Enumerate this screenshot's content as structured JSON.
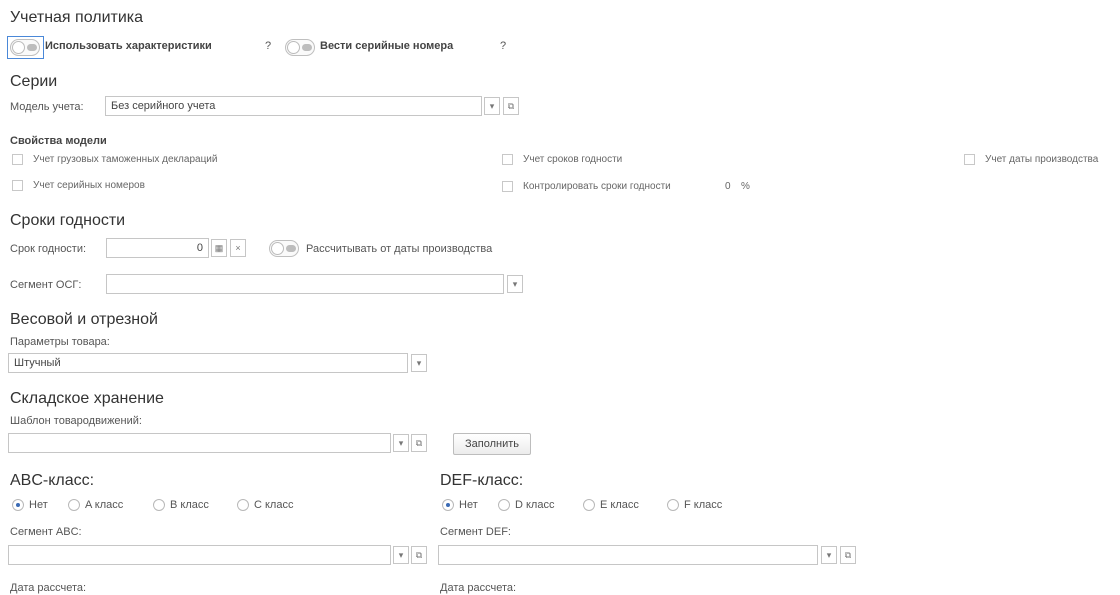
{
  "accounting_policy": {
    "title": "Учетная политика",
    "use_characteristics_label": "Использовать характеристики",
    "use_serials_label": "Вести серийные номера",
    "help": "?"
  },
  "series": {
    "title": "Серии",
    "model_label": "Модель учета:",
    "model_value": "Без серийного учета",
    "props_title": "Свойства модели",
    "props": {
      "gtd": "Учет грузовых таможенных деклараций",
      "serials": "Учет серийных номеров",
      "expiry": "Учет сроков годности",
      "control_expiry": "Контролировать сроки годности",
      "prod_date": "Учет даты производства"
    },
    "control_percent_value": "0",
    "percent_sign": "%"
  },
  "expiry": {
    "title": "Сроки годности",
    "term_label": "Срок годности:",
    "term_value": "0",
    "calc_from_prod_label": "Рассчитывать от даты производства",
    "segment_label": "Сегмент ОСГ:",
    "segment_value": ""
  },
  "weight": {
    "title": "Весовой и отрезной",
    "params_label": "Параметры товара:",
    "params_value": "Штучный"
  },
  "storage": {
    "title": "Складское хранение",
    "template_label": "Шаблон товародвижений:",
    "template_value": "",
    "fill_button": "Заполнить"
  },
  "abc": {
    "title": "ABC-класс:",
    "options": [
      "Нет",
      "A класс",
      "B класс",
      "C класс"
    ],
    "selected": "Нет",
    "segment_label": "Сегмент ABC:",
    "segment_value": "",
    "date_label": "Дата рассчета:"
  },
  "def": {
    "title": "DEF-класс:",
    "options": [
      "Нет",
      "D класс",
      "E класс",
      "F класс"
    ],
    "selected": "Нет",
    "segment_label": "Сегмент DEF:",
    "segment_value": "",
    "date_label": "Дата рассчета:"
  },
  "colors": {
    "focus": "#4a88d8",
    "radio_dot": "#3b6bb5"
  },
  "icons": [
    "dropdown-arrow-icon",
    "open-form-icon",
    "calendar-icon",
    "clear-icon"
  ]
}
